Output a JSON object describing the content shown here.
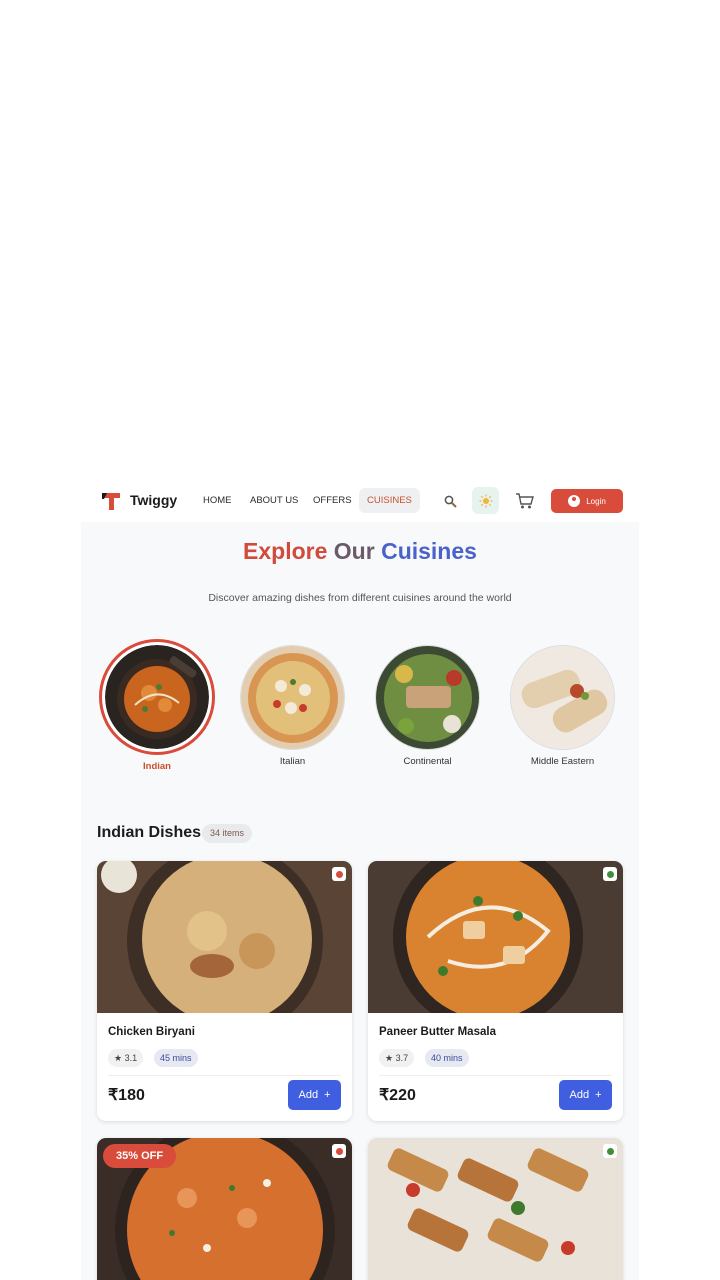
{
  "nav": {
    "brand": "Twiggy",
    "links": [
      "HOME",
      "ABOUT US",
      "OFFERS",
      "CUISINES"
    ],
    "active_link": "CUISINES",
    "login_label": "Login",
    "icons": [
      "search-icon",
      "sun-icon",
      "cart-icon",
      "user-icon"
    ]
  },
  "hero": {
    "title_part1": "Explore",
    "title_part2": "Our",
    "title_part3": "Cuisines",
    "subtitle": "Discover amazing dishes from different cuisines around the world"
  },
  "cuisines": [
    {
      "label": "Indian",
      "active": true
    },
    {
      "label": "Italian",
      "active": false
    },
    {
      "label": "Continental",
      "active": false
    },
    {
      "label": "Middle Eastern",
      "active": false
    }
  ],
  "section": {
    "title": "Indian Dishes",
    "count": "34 items"
  },
  "dishes": [
    {
      "name": "Chicken Biryani",
      "rating": "3.1",
      "time": "45 mins",
      "price": "₹180",
      "add_label": "Add",
      "veg": false
    },
    {
      "name": "Paneer Butter Masala",
      "rating": "3.7",
      "time": "40 mins",
      "price": "₹220",
      "add_label": "Add",
      "veg": true
    },
    {
      "offer": "35% OFF",
      "veg": false
    },
    {
      "veg": true
    }
  ],
  "colors": {
    "accent_red": "#d94b3b",
    "accent_blue": "#3f5fe0",
    "title_blue": "#4a63c9"
  }
}
